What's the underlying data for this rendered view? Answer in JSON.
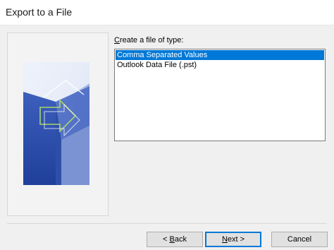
{
  "window": {
    "title": "Export to a File"
  },
  "prompt": {
    "underlined": "C",
    "rest": "reate a file of type:"
  },
  "file_types": [
    {
      "label": "Comma Separated Values",
      "selected": true
    },
    {
      "label": "Outlook Data File (.pst)",
      "selected": false
    }
  ],
  "buttons": {
    "back": {
      "prefix": "< ",
      "underlined": "B",
      "rest": "ack"
    },
    "next": {
      "underlined": "N",
      "rest": "ext >"
    },
    "cancel": "Cancel"
  },
  "colors": {
    "selection": "#0078d7",
    "art_dark": "#2f4fa8",
    "art_light": "#dde6f6"
  },
  "icons": {
    "wizard_art": "export-wizard-graphic"
  }
}
